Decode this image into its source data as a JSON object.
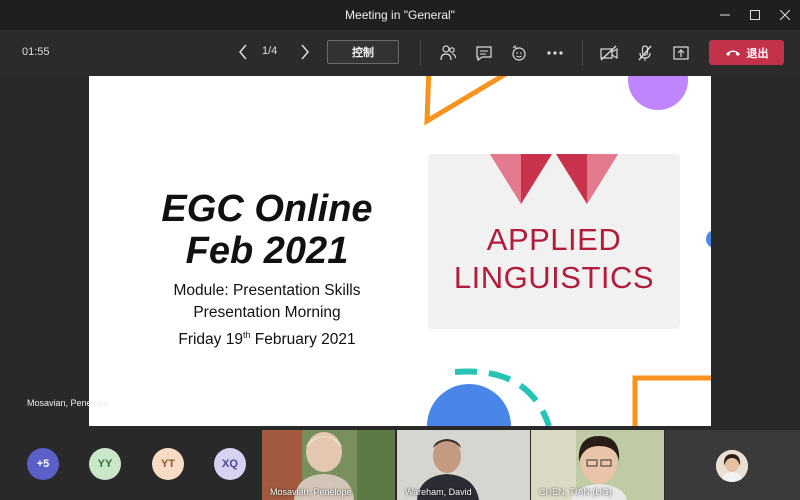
{
  "window": {
    "title": "Meeting in \"General\"",
    "controls": [
      "minimize",
      "maximize",
      "close"
    ]
  },
  "toolbar": {
    "timer": "01:55",
    "page_indicator": "1/4",
    "control_label": "控制",
    "leave_label": "退出",
    "icons": [
      "participants-icon",
      "chat-icon",
      "reactions-icon",
      "more-icon",
      "camera-off-icon",
      "mic-off-icon",
      "share-tray-icon",
      "hang-up-icon"
    ],
    "colors": {
      "leave": "#c4314b"
    }
  },
  "slide": {
    "title_line1": "EGC Online",
    "title_line2": "Feb 2021",
    "subtitle_line1": "Module: Presentation Skills",
    "subtitle_line2": "Presentation Morning",
    "date_prefix": "Friday 19",
    "date_sup": "th",
    "date_suffix": " February 2021",
    "logo_line1": "APPLIED",
    "logo_line2": "LINGUISTICS",
    "colors": {
      "logo": "#b01c3a",
      "orange": "#f7931e",
      "purple": "#c084fc",
      "blue": "#4a86e8",
      "teal": "#27c3b5"
    }
  },
  "presenter": {
    "name": "Mosavian, Penelope"
  },
  "gallery": {
    "overflow_badge": "+5",
    "avatars": [
      {
        "initials": "YY",
        "bg": "#c9e8c9",
        "fg": "#3a6b3a"
      },
      {
        "initials": "YT",
        "bg": "#f6dcc6",
        "fg": "#8a5a2b"
      },
      {
        "initials": "XQ",
        "bg": "#d6d3f2",
        "fg": "#4b4593"
      }
    ],
    "tiles": [
      {
        "name": "Mosavian, Penelope"
      },
      {
        "name": "Wareham, David"
      },
      {
        "name": "CHEN, TIAN (UG)"
      }
    ]
  }
}
